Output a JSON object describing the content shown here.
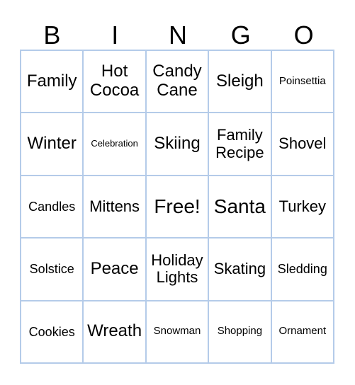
{
  "header": {
    "letters": [
      "B",
      "I",
      "N",
      "G",
      "O"
    ]
  },
  "board": {
    "rows": [
      [
        "Family",
        "Hot Cocoa",
        "Candy Cane",
        "Sleigh",
        "Poinsettia"
      ],
      [
        "Winter",
        "Celebration",
        "Skiing",
        "Family Recipe",
        "Shovel"
      ],
      [
        "Candles",
        "Mittens",
        "Free!",
        "Santa",
        "Turkey"
      ],
      [
        "Solstice",
        "Peace",
        "Holiday Lights",
        "Skating",
        "Sledding"
      ],
      [
        "Cookies",
        "Wreath",
        "Snowman",
        "Shopping",
        "Ornament"
      ]
    ]
  },
  "colors": {
    "grid_line": "#b4cbe9",
    "text": "#000000",
    "background": "#ffffff"
  }
}
